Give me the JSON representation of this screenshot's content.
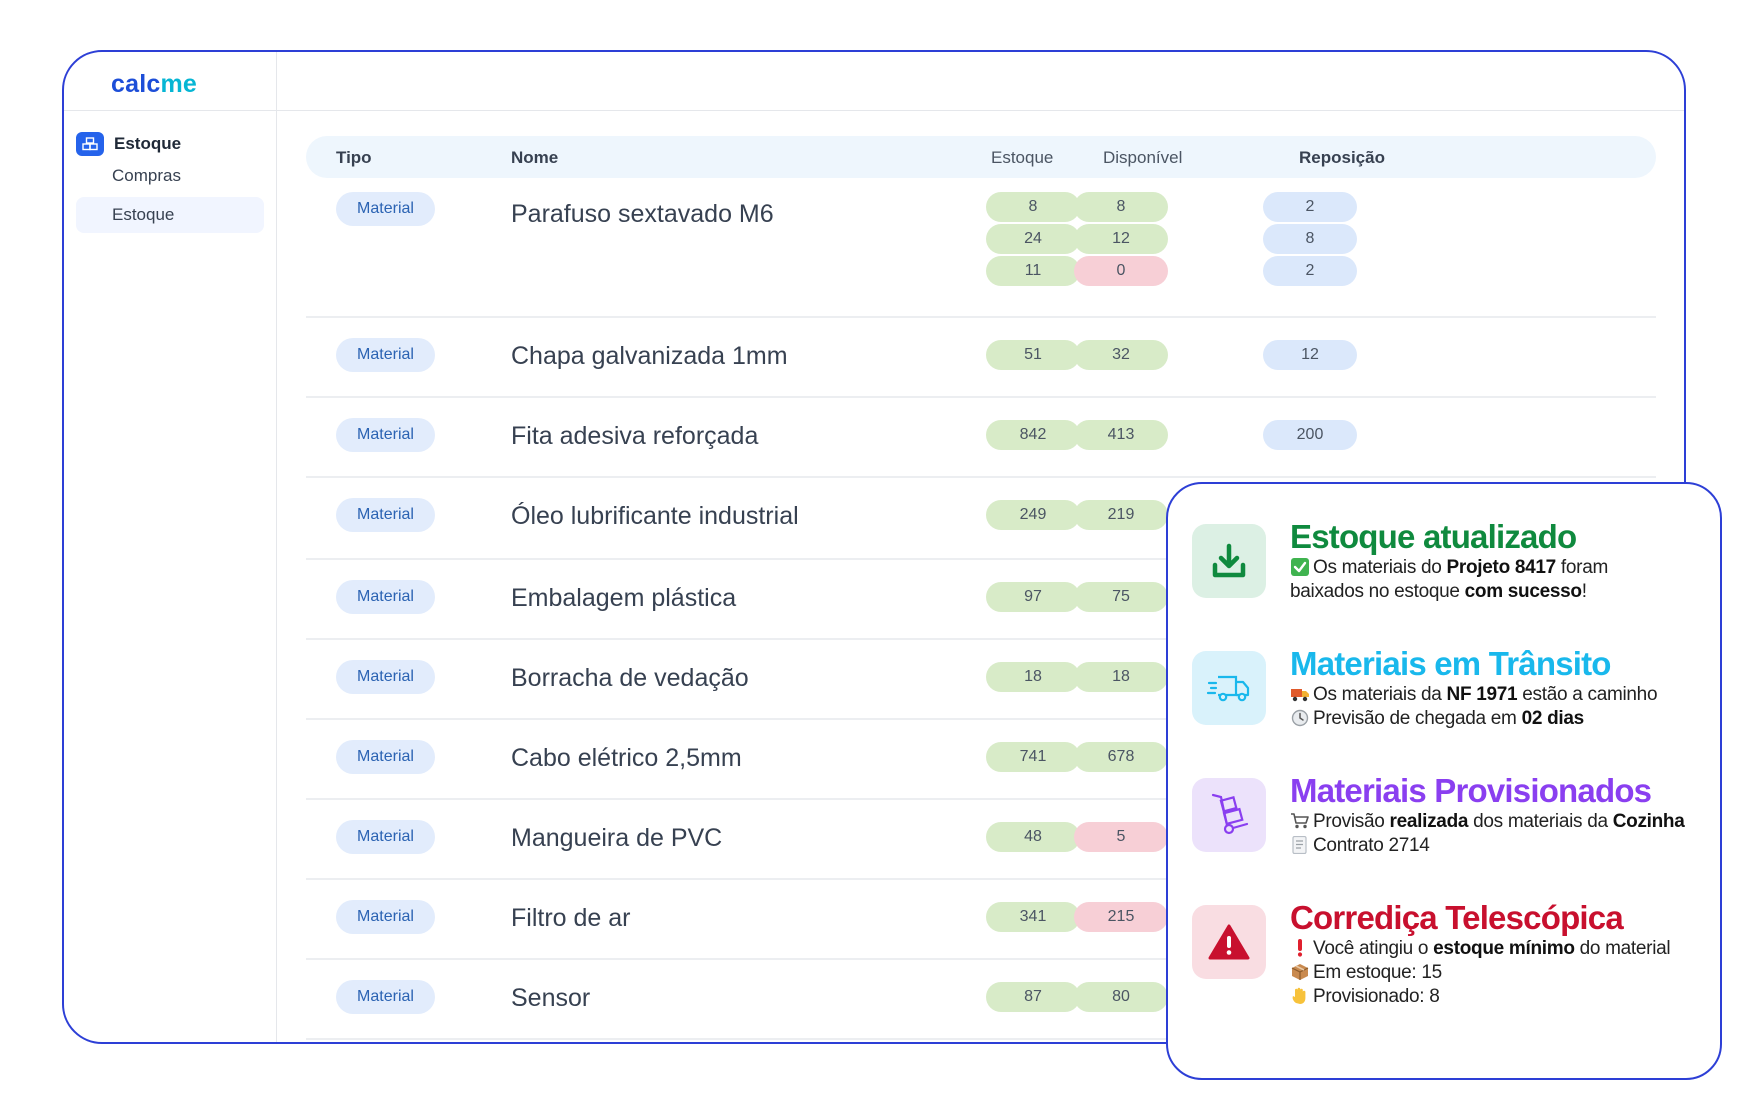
{
  "logo": {
    "part1": "calc",
    "part2": "me"
  },
  "sidebar": {
    "group_label": "Estoque",
    "items": [
      {
        "label": "Compras",
        "active": false
      },
      {
        "label": "Estoque",
        "active": true
      }
    ]
  },
  "table": {
    "headers": {
      "tipo": "Tipo",
      "nome": "Nome",
      "estoque": "Estoque",
      "disponivel": "Disponível",
      "reposicao": "Reposição"
    },
    "rows": [
      {
        "tipo": "Material",
        "nome": "Parafuso sextavado M6",
        "estoque": [
          "8",
          "24",
          "11"
        ],
        "disponivel": [
          "8",
          "12",
          "0"
        ],
        "disponivel_status": [
          "ok",
          "ok",
          "low"
        ],
        "reposicao": [
          "2",
          "8",
          "2"
        ]
      },
      {
        "tipo": "Material",
        "nome": "Chapa galvanizada 1mm",
        "estoque": [
          "51"
        ],
        "disponivel": [
          "32"
        ],
        "disponivel_status": [
          "ok"
        ],
        "reposicao": [
          "12"
        ]
      },
      {
        "tipo": "Material",
        "nome": "Fita adesiva reforçada",
        "estoque": [
          "842"
        ],
        "disponivel": [
          "413"
        ],
        "disponivel_status": [
          "ok"
        ],
        "reposicao": [
          "200"
        ]
      },
      {
        "tipo": "Material",
        "nome": "Óleo lubrificante industrial",
        "estoque": [
          "249"
        ],
        "disponivel": [
          "219"
        ],
        "disponivel_status": [
          "ok"
        ],
        "reposicao": []
      },
      {
        "tipo": "Material",
        "nome": "Embalagem plástica",
        "estoque": [
          "97"
        ],
        "disponivel": [
          "75"
        ],
        "disponivel_status": [
          "ok"
        ],
        "reposicao": []
      },
      {
        "tipo": "Material",
        "nome": "Borracha de vedação",
        "estoque": [
          "18"
        ],
        "disponivel": [
          "18"
        ],
        "disponivel_status": [
          "ok"
        ],
        "reposicao": []
      },
      {
        "tipo": "Material",
        "nome": "Cabo elétrico 2,5mm",
        "estoque": [
          "741"
        ],
        "disponivel": [
          "678"
        ],
        "disponivel_status": [
          "ok"
        ],
        "reposicao": []
      },
      {
        "tipo": "Material",
        "nome": "Mangueira de PVC",
        "estoque": [
          "48"
        ],
        "disponivel": [
          "5"
        ],
        "disponivel_status": [
          "low"
        ],
        "reposicao": []
      },
      {
        "tipo": "Material",
        "nome": "Filtro de ar",
        "estoque": [
          "341"
        ],
        "disponivel": [
          "215"
        ],
        "disponivel_status": [
          "low"
        ],
        "reposicao": []
      },
      {
        "tipo": "Material",
        "nome": "Sensor",
        "estoque": [
          "87"
        ],
        "disponivel": [
          "80"
        ],
        "disponivel_status": [
          "ok"
        ],
        "reposicao": []
      }
    ]
  },
  "notifications": [
    {
      "icon": "download-icon",
      "color": "#0f8a3e",
      "bg": "#dcf0e4",
      "title": "Estoque atualizado",
      "lines": [
        {
          "emoji": "check-icon",
          "parts": [
            {
              "t": "Os materiais do "
            },
            {
              "t": "Projeto 8417",
              "b": true
            },
            {
              "t": " foram"
            }
          ]
        },
        {
          "emoji": null,
          "parts": [
            {
              "t": "baixados no estoque "
            },
            {
              "t": "com sucesso",
              "b": true
            },
            {
              "t": "!"
            }
          ]
        }
      ]
    },
    {
      "icon": "truck-icon",
      "color": "#19b8ec",
      "bg": "#d9f2fb",
      "title": "Materiais em Trânsito",
      "lines": [
        {
          "emoji": "delivery-truck-icon",
          "parts": [
            {
              "t": "Os materiais da "
            },
            {
              "t": "NF 1971",
              "b": true
            },
            {
              "t": " estão a caminho"
            }
          ]
        },
        {
          "emoji": "clock-icon",
          "parts": [
            {
              "t": "Previsão de chegada em "
            },
            {
              "t": "02 dias",
              "b": true
            }
          ]
        }
      ]
    },
    {
      "icon": "hand-truck-icon",
      "color": "#8a3ff0",
      "bg": "#ece2fb",
      "title": "Materiais Provisionados",
      "lines": [
        {
          "emoji": "cart-icon",
          "parts": [
            {
              "t": "Provisão "
            },
            {
              "t": "realizada",
              "b": true
            },
            {
              "t": " dos materiais da "
            },
            {
              "t": "Cozinha",
              "b": true
            }
          ]
        },
        {
          "emoji": "document-icon",
          "parts": [
            {
              "t": "Contrato 2714"
            }
          ]
        }
      ]
    },
    {
      "icon": "warning-icon",
      "color": "#c8102e",
      "bg": "#f9dde2",
      "title": "Corrediça Telescópica",
      "lines": [
        {
          "emoji": "exclamation-icon",
          "parts": [
            {
              "t": "Você atingiu o "
            },
            {
              "t": "estoque mínimo",
              "b": true
            },
            {
              "t": " do material"
            }
          ]
        },
        {
          "emoji": "package-icon",
          "parts": [
            {
              "t": "Em estoque: 15"
            }
          ]
        },
        {
          "emoji": "hand-icon",
          "parts": [
            {
              "t": "Provisionado: 8"
            }
          ]
        }
      ]
    }
  ]
}
